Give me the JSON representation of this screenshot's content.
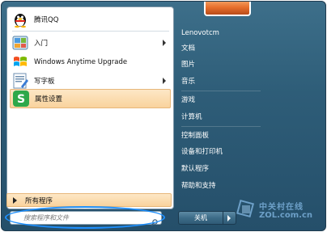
{
  "left_menu": {
    "items": [
      {
        "label": "腾讯QQ",
        "icon": "qq-penguin-icon",
        "arrow": false,
        "selected": false
      },
      {
        "label": "入门",
        "icon": "getting-started-icon",
        "arrow": true,
        "selected": false
      },
      {
        "label": "Windows Anytime Upgrade",
        "icon": "windows-logo-icon",
        "arrow": false,
        "selected": false
      },
      {
        "label": "写字板",
        "icon": "wordpad-icon",
        "arrow": true,
        "selected": false
      },
      {
        "label": "属性设置",
        "icon": "sogou-s-icon",
        "arrow": false,
        "selected": true
      }
    ],
    "all_programs_label": "所有程序"
  },
  "search": {
    "placeholder": "搜索程序和文件"
  },
  "right_menu": {
    "items": [
      "Lenovotcm",
      "文档",
      "图片",
      "音乐",
      "游戏",
      "计算机",
      "控制面板",
      "设备和打印机",
      "默认程序",
      "帮助和支持"
    ]
  },
  "shutdown": {
    "label": "关机"
  },
  "watermark": {
    "line1": "中关村在线",
    "line2": "ZOL.com.cn"
  },
  "colors": {
    "highlight_oval": "#1e90ff",
    "selected_bg": "#f9d39d",
    "frame_bg": "#2e5d78"
  }
}
